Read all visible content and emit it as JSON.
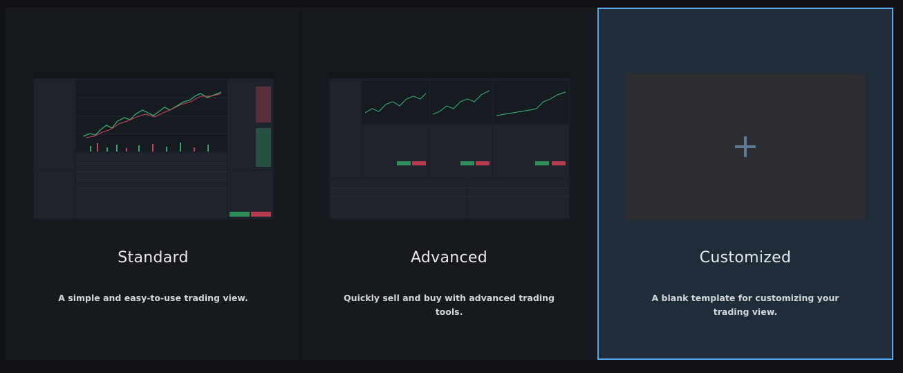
{
  "templates": [
    {
      "title": "Standard",
      "description": "A simple and easy-to-use trading view."
    },
    {
      "title": "Advanced",
      "description": "Quickly sell and buy with advanced trading tools."
    },
    {
      "title": "Customized",
      "description": "A blank template for customizing your trading view.",
      "selected": true,
      "icon": "plus-icon"
    }
  ],
  "colors": {
    "background": "#0f1114",
    "card": "#16191e",
    "selected_card": "#1f2c3a",
    "selected_border": "#5aa7e6",
    "up": "#36a56a",
    "down": "#c9475a"
  }
}
